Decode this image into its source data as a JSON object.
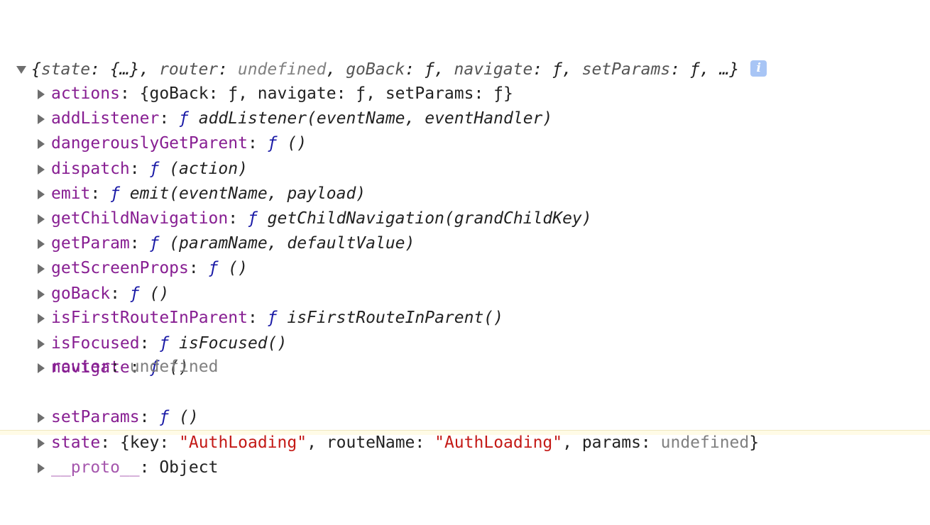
{
  "header": {
    "open_brace": "{",
    "state_key": "state",
    "state_sep": ": ",
    "state_val": "{…}",
    "comma1": ", ",
    "router_key": "router",
    "router_sep": ": ",
    "router_val": "undefined",
    "comma2": ", ",
    "goback_key": "goBack",
    "goback_sep": ": ",
    "goback_val": "ƒ",
    "comma3": ", ",
    "navigate_key": "navigate",
    "navigate_sep": ": ",
    "navigate_val": "ƒ",
    "comma4": ", ",
    "setparams_key": "setParams",
    "setparams_sep": ": ",
    "setparams_val": "ƒ",
    "tail": ", …}",
    "info_icon": "i"
  },
  "props": {
    "actions": {
      "key": "actions",
      "sep": ": ",
      "value": "{goBack: ƒ, navigate: ƒ, setParams: ƒ}"
    },
    "addListener": {
      "key": "addListener",
      "sep": ": ",
      "f": "ƒ",
      "sig": " addListener(eventName, eventHandler)"
    },
    "dangerouslyGetParent": {
      "key": "dangerouslyGetParent",
      "sep": ": ",
      "f": "ƒ",
      "sig": " ()"
    },
    "dispatch": {
      "key": "dispatch",
      "sep": ": ",
      "f": "ƒ",
      "sig": " (action)"
    },
    "emit": {
      "key": "emit",
      "sep": ": ",
      "f": "ƒ",
      "sig": " emit(eventName, payload)"
    },
    "getChildNavigation": {
      "key": "getChildNavigation",
      "sep": ": ",
      "f": "ƒ",
      "sig": " getChildNavigation(grandChildKey)"
    },
    "getParam": {
      "key": "getParam",
      "sep": ": ",
      "f": "ƒ",
      "sig": " (paramName, defaultValue)"
    },
    "getScreenProps": {
      "key": "getScreenProps",
      "sep": ": ",
      "f": "ƒ",
      "sig": " ()"
    },
    "goBack": {
      "key": "goBack",
      "sep": ": ",
      "f": "ƒ",
      "sig": " ()"
    },
    "isFirstRouteInParent": {
      "key": "isFirstRouteInParent",
      "sep": ": ",
      "f": "ƒ",
      "sig": " isFirstRouteInParent()"
    },
    "isFocused": {
      "key": "isFocused",
      "sep": ": ",
      "f": "ƒ",
      "sig": " isFocused()"
    },
    "navigate": {
      "key": "navigate",
      "sep": ": ",
      "f": "ƒ",
      "sig": " ()"
    },
    "router": {
      "key": "router",
      "sep": ": ",
      "value": "undefined"
    },
    "setParams": {
      "key": "setParams",
      "sep": ": ",
      "f": "ƒ",
      "sig": " ()"
    },
    "state": {
      "key": "state",
      "sep": ": ",
      "open": "{",
      "k1": "key",
      "s1": ": ",
      "v1": "\"AuthLoading\"",
      "c1": ", ",
      "k2": "routeName",
      "s2": ": ",
      "v2": "\"AuthLoading\"",
      "c2": ", ",
      "k3": "params",
      "s3": ": ",
      "v3": "undefined",
      "close": "}"
    },
    "proto": {
      "key": "__proto__",
      "sep": ": ",
      "value": "Object"
    }
  },
  "colors": {
    "property_key": "#871e92",
    "function_f": "#1a1aa6",
    "string": "#c41a16",
    "undefined": "#808080",
    "info_badge": "#a8c5f5"
  },
  "icons": {
    "expanded": "triangle-down-icon",
    "collapsed": "triangle-right-icon",
    "info": "info-icon"
  }
}
